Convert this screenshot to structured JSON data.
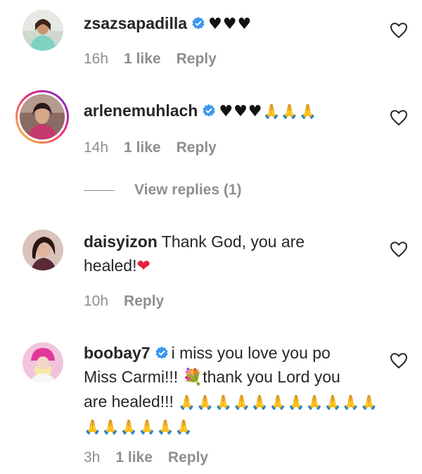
{
  "comments": [
    {
      "username": "zsazsapadilla",
      "verified": true,
      "text": "",
      "emoji_hearts": "♥♥♥",
      "emoji_pray": "",
      "time": "16h",
      "likes": "1 like",
      "reply": "Reply"
    },
    {
      "username": "arlenemuhlach",
      "verified": true,
      "text": "",
      "emoji_hearts": "♥♥♥",
      "emoji_pray": "🙏🙏🙏",
      "time": "14h",
      "likes": "1 like",
      "reply": "Reply",
      "view_replies": "View replies (1)"
    },
    {
      "username": "daisyizon",
      "verified": false,
      "text_1": "Thank God, you are",
      "text_2": "healed!",
      "emoji_heart": "❤",
      "time": "10h",
      "reply": "Reply"
    },
    {
      "username": "boobay7",
      "verified": true,
      "text_1": "i miss you love you po",
      "text_2a": "Miss Carmi!!! ",
      "emoji_flower": "💐",
      "text_2b": "thank you Lord you",
      "text_3": "are healed!!! ",
      "emoji_pray_1": "🙏🙏🙏🙏🙏🙏🙏🙏🙏🙏🙏",
      "emoji_pray_2": "🙏🙏🙏🙏🙏🙏",
      "time": "3h",
      "likes": "1 like",
      "reply": "Reply"
    }
  ],
  "icons": {
    "verified": "verified-badge-icon",
    "like": "heart-outline-icon"
  },
  "colors": {
    "text": "#262626",
    "meta": "#8e8e8e",
    "verified": "#3897f0"
  }
}
